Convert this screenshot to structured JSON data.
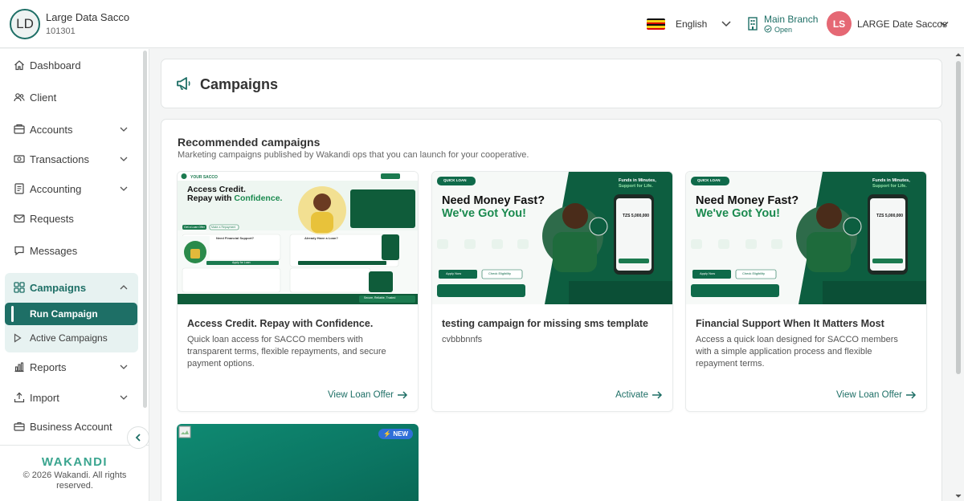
{
  "header": {
    "org_initials": "LD",
    "org_name": "Large Data Sacco",
    "org_code": "101301",
    "language": "English",
    "branch_name": "Main Branch",
    "branch_status": "Open",
    "user_initials": "LS",
    "user_name": "LARGE Date Saccos",
    "colors": {
      "accent": "#1e6f66",
      "user_avatar": "#e56874"
    }
  },
  "sidebar": {
    "items": [
      {
        "label": "Dashboard",
        "icon": "home-icon"
      },
      {
        "label": "Client",
        "icon": "users-icon"
      },
      {
        "label": "Accounts",
        "icon": "bank-icon",
        "expandable": true
      },
      {
        "label": "Transactions",
        "icon": "money-icon",
        "expandable": true
      },
      {
        "label": "Accounting",
        "icon": "ledger-icon",
        "expandable": true
      },
      {
        "label": "Requests",
        "icon": "mail-icon"
      },
      {
        "label": "Messages",
        "icon": "chat-icon"
      },
      {
        "label": "Campaigns",
        "icon": "grid-icon",
        "expandable": true,
        "expanded": true
      },
      {
        "label": "Reports",
        "icon": "chart-icon",
        "expandable": true
      },
      {
        "label": "Import",
        "icon": "upload-icon",
        "expandable": true
      },
      {
        "label": "Business Account",
        "icon": "briefcase-icon"
      }
    ],
    "campaigns_sub": [
      {
        "label": "Run Campaign",
        "active": true
      },
      {
        "label": "Active Campaigns",
        "active": false
      }
    ],
    "brand": "WAKANDI",
    "copyright": "© 2026 Wakandi. All rights reserved."
  },
  "main": {
    "page_title": "Campaigns",
    "section_title": "Recommended campaigns",
    "section_subtitle": "Marketing campaigns published by Wakandi ops that you can launch for your cooperative.",
    "campaigns": [
      {
        "title": "Access Credit. Repay with Confidence.",
        "description": "Quick loan access for SACCO members with transparent terms, flexible repayments, and secure payment options.",
        "action": "View Loan Offer",
        "banner": {
          "brand": "YOUR SACCO",
          "headline_1": "Access Credit.",
          "headline_2": "Repay with ",
          "headline_highlight": "Confidence.",
          "button_1": "Get a Loan Offer",
          "button_2": "Make a Repayment",
          "panel_1": "Need Financial Support?",
          "panel_2": "Already Have a Loan?",
          "apply": "Apply for Loan",
          "footer": "Secure, Reliable, Trusted"
        }
      },
      {
        "title": "testing campaign for missing sms template",
        "description": "cvbbbnnfs",
        "action": "Activate",
        "banner": {
          "tag": "QUICK LOAN",
          "headline_1": "Need Money Fast?",
          "headline_2": "We've Got You!",
          "side_1": "Funds in Minutes,",
          "side_2": "Support for Life.",
          "apply": "Apply Now",
          "check": "Check Eligibility",
          "amount": "TZS 5,000,000"
        }
      },
      {
        "title": "Financial Support When It Matters Most",
        "description": "Access a quick loan designed for SACCO members with a simple application process and flexible repayment terms.",
        "action": "View Loan Offer",
        "banner": {
          "tag": "QUICK LOAN",
          "headline_1": "Need Money Fast?",
          "headline_2": "We've Got You!",
          "side_1": "Funds in Minutes,",
          "side_2": "Support for Life.",
          "apply": "Apply Now",
          "check": "Check Eligibility",
          "amount": "TZS 5,000,000"
        }
      }
    ],
    "new_badge": "NEW"
  }
}
